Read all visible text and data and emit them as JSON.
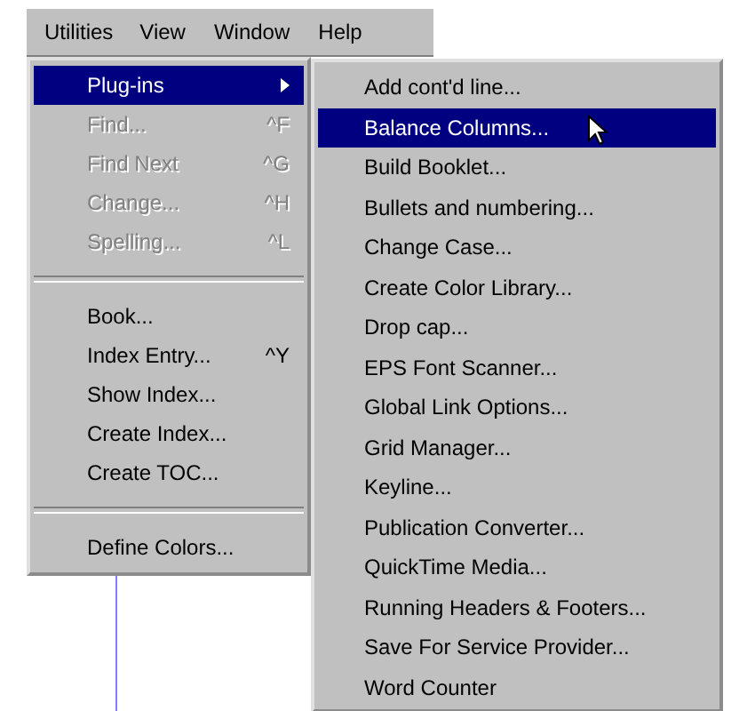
{
  "menu_bar": [
    {
      "label": "Utilities",
      "selected": true
    },
    {
      "label": "View",
      "selected": false
    },
    {
      "label": "Window",
      "selected": false
    },
    {
      "label": "Help",
      "selected": false
    }
  ],
  "utilities_menu": [
    {
      "kind": "item",
      "label": "Plug-ins",
      "submenu": true,
      "selected": true,
      "disabled": false
    },
    {
      "kind": "item",
      "label": "Find...",
      "shortcut": "^F",
      "selected": false,
      "disabled": true
    },
    {
      "kind": "item",
      "label": "Find Next",
      "shortcut": "^G",
      "selected": false,
      "disabled": true
    },
    {
      "kind": "item",
      "label": "Change...",
      "shortcut": "^H",
      "selected": false,
      "disabled": true
    },
    {
      "kind": "item",
      "label": "Spelling...",
      "shortcut": "^L",
      "selected": false,
      "disabled": true
    },
    {
      "kind": "separator"
    },
    {
      "kind": "item",
      "label": "Book...",
      "selected": false,
      "disabled": false
    },
    {
      "kind": "item",
      "label": "Index Entry...",
      "shortcut": "^Y",
      "selected": false,
      "disabled": false
    },
    {
      "kind": "item",
      "label": "Show Index...",
      "selected": false,
      "disabled": false
    },
    {
      "kind": "item",
      "label": "Create Index...",
      "selected": false,
      "disabled": false
    },
    {
      "kind": "item",
      "label": "Create TOC...",
      "selected": false,
      "disabled": false
    },
    {
      "kind": "separator"
    },
    {
      "kind": "item",
      "label": "Define Colors...",
      "selected": false,
      "disabled": false
    }
  ],
  "plugins_submenu": [
    {
      "label": "Add cont'd line...",
      "selected": false
    },
    {
      "label": "Balance Columns...",
      "selected": true
    },
    {
      "label": "Build Booklet...",
      "selected": false
    },
    {
      "label": "Bullets and numbering...",
      "selected": false
    },
    {
      "label": "Change Case...",
      "selected": false
    },
    {
      "label": "Create Color Library...",
      "selected": false
    },
    {
      "label": "Drop cap...",
      "selected": false
    },
    {
      "label": "EPS Font Scanner...",
      "selected": false
    },
    {
      "label": "Global Link Options...",
      "selected": false
    },
    {
      "label": "Grid Manager...",
      "selected": false
    },
    {
      "label": "Keyline...",
      "selected": false
    },
    {
      "label": "Publication Converter...",
      "selected": false
    },
    {
      "label": "QuickTime Media...",
      "selected": false
    },
    {
      "label": "Running Headers & Footers...",
      "selected": false
    },
    {
      "label": "Save For Service Provider...",
      "selected": false
    },
    {
      "label": "Word Counter",
      "selected": false
    }
  ]
}
